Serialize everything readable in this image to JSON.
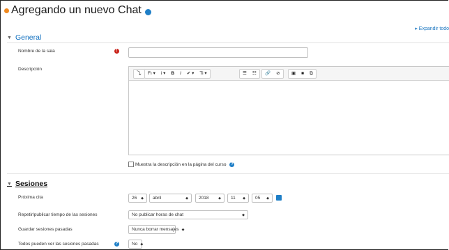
{
  "page": {
    "title": "Agregando un nuevo Chat",
    "expand_all": "▸ Expandir todo"
  },
  "general": {
    "heading": "General",
    "room_name_label": "Nombre de la sala",
    "room_name_value": "",
    "description_label": "Descripción",
    "show_description": "Muestra la descripción en la página del curso"
  },
  "toolbar": {
    "items": [
      "⤵",
      "Fı ▾",
      "i ▾",
      "B",
      "I",
      "✔ ▾",
      "Ti ▾",
      "☰",
      "☷",
      "🔗",
      "⊘",
      "▣",
      "■",
      "⧉"
    ]
  },
  "sesiones": {
    "heading": "Sesiones",
    "next_date_label": "Próxima cita",
    "day": "26",
    "month": "abril",
    "year": "2018",
    "hour": "11",
    "minute": "05",
    "repeat_label": "Repetir/publicar tiempo de las sesiones",
    "repeat_value": "No publicar horas de chat",
    "save_label": "Guardar sesiones pasadas",
    "save_value": "Nunca borrar mensajes",
    "everyone_label": "Todos pueden ver las sesiones pasadas",
    "everyone_value": "No"
  },
  "colors": {
    "accent": "#0f6fbf",
    "required": "#c9241b",
    "brand": "#f0891f"
  }
}
